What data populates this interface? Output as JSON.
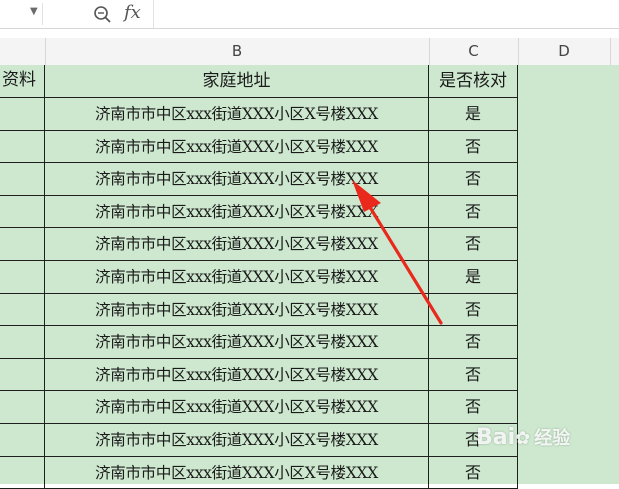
{
  "colors": {
    "grid_green": "#cde8cf",
    "arrow_red": "#e8291c"
  },
  "formula_bar": {
    "fx_label": "fx",
    "zoom_icon": "zoom-search-icon",
    "dropdown_icon": "chevron-down-icon"
  },
  "columns": [
    "B",
    "C",
    "D"
  ],
  "sheet": {
    "left_header": "资料",
    "address_header": "家庭地址",
    "verified_header": "是否核对",
    "rows": [
      {
        "address": "济南市市中区xxx街道XXX小区X号楼XXX",
        "verified": "是"
      },
      {
        "address": "济南市市中区xxx街道XXX小区X号楼XXX",
        "verified": "否"
      },
      {
        "address": "济南市市中区xxx街道XXX小区X号楼XXX",
        "verified": "否"
      },
      {
        "address": "济南市市中区xxx街道XXX小区X号楼XXX",
        "verified": "否"
      },
      {
        "address": "济南市市中区xxx街道XXX小区X号楼XXX",
        "verified": "否"
      },
      {
        "address": "济南市市中区xxx街道XXX小区X号楼XXX",
        "verified": "是"
      },
      {
        "address": "济南市市中区xxx街道XXX小区X号楼XXX",
        "verified": "否"
      },
      {
        "address": "济南市市中区xxx街道XXX小区X号楼XXX",
        "verified": "否"
      },
      {
        "address": "济南市市中区xxx街道XXX小区X号楼XXX",
        "verified": "否"
      },
      {
        "address": "济南市市中区xxx街道XXX小区X号楼XXX",
        "verified": "否"
      },
      {
        "address": "济南市市中区xxx街道XXX小区X号楼XXX",
        "verified": "否"
      },
      {
        "address": "济南市市中区xxx街道XXX小区X号楼XXX",
        "verified": "否"
      }
    ]
  },
  "watermark": {
    "brand": "Bai",
    "paw": "du",
    "text": "经验"
  }
}
